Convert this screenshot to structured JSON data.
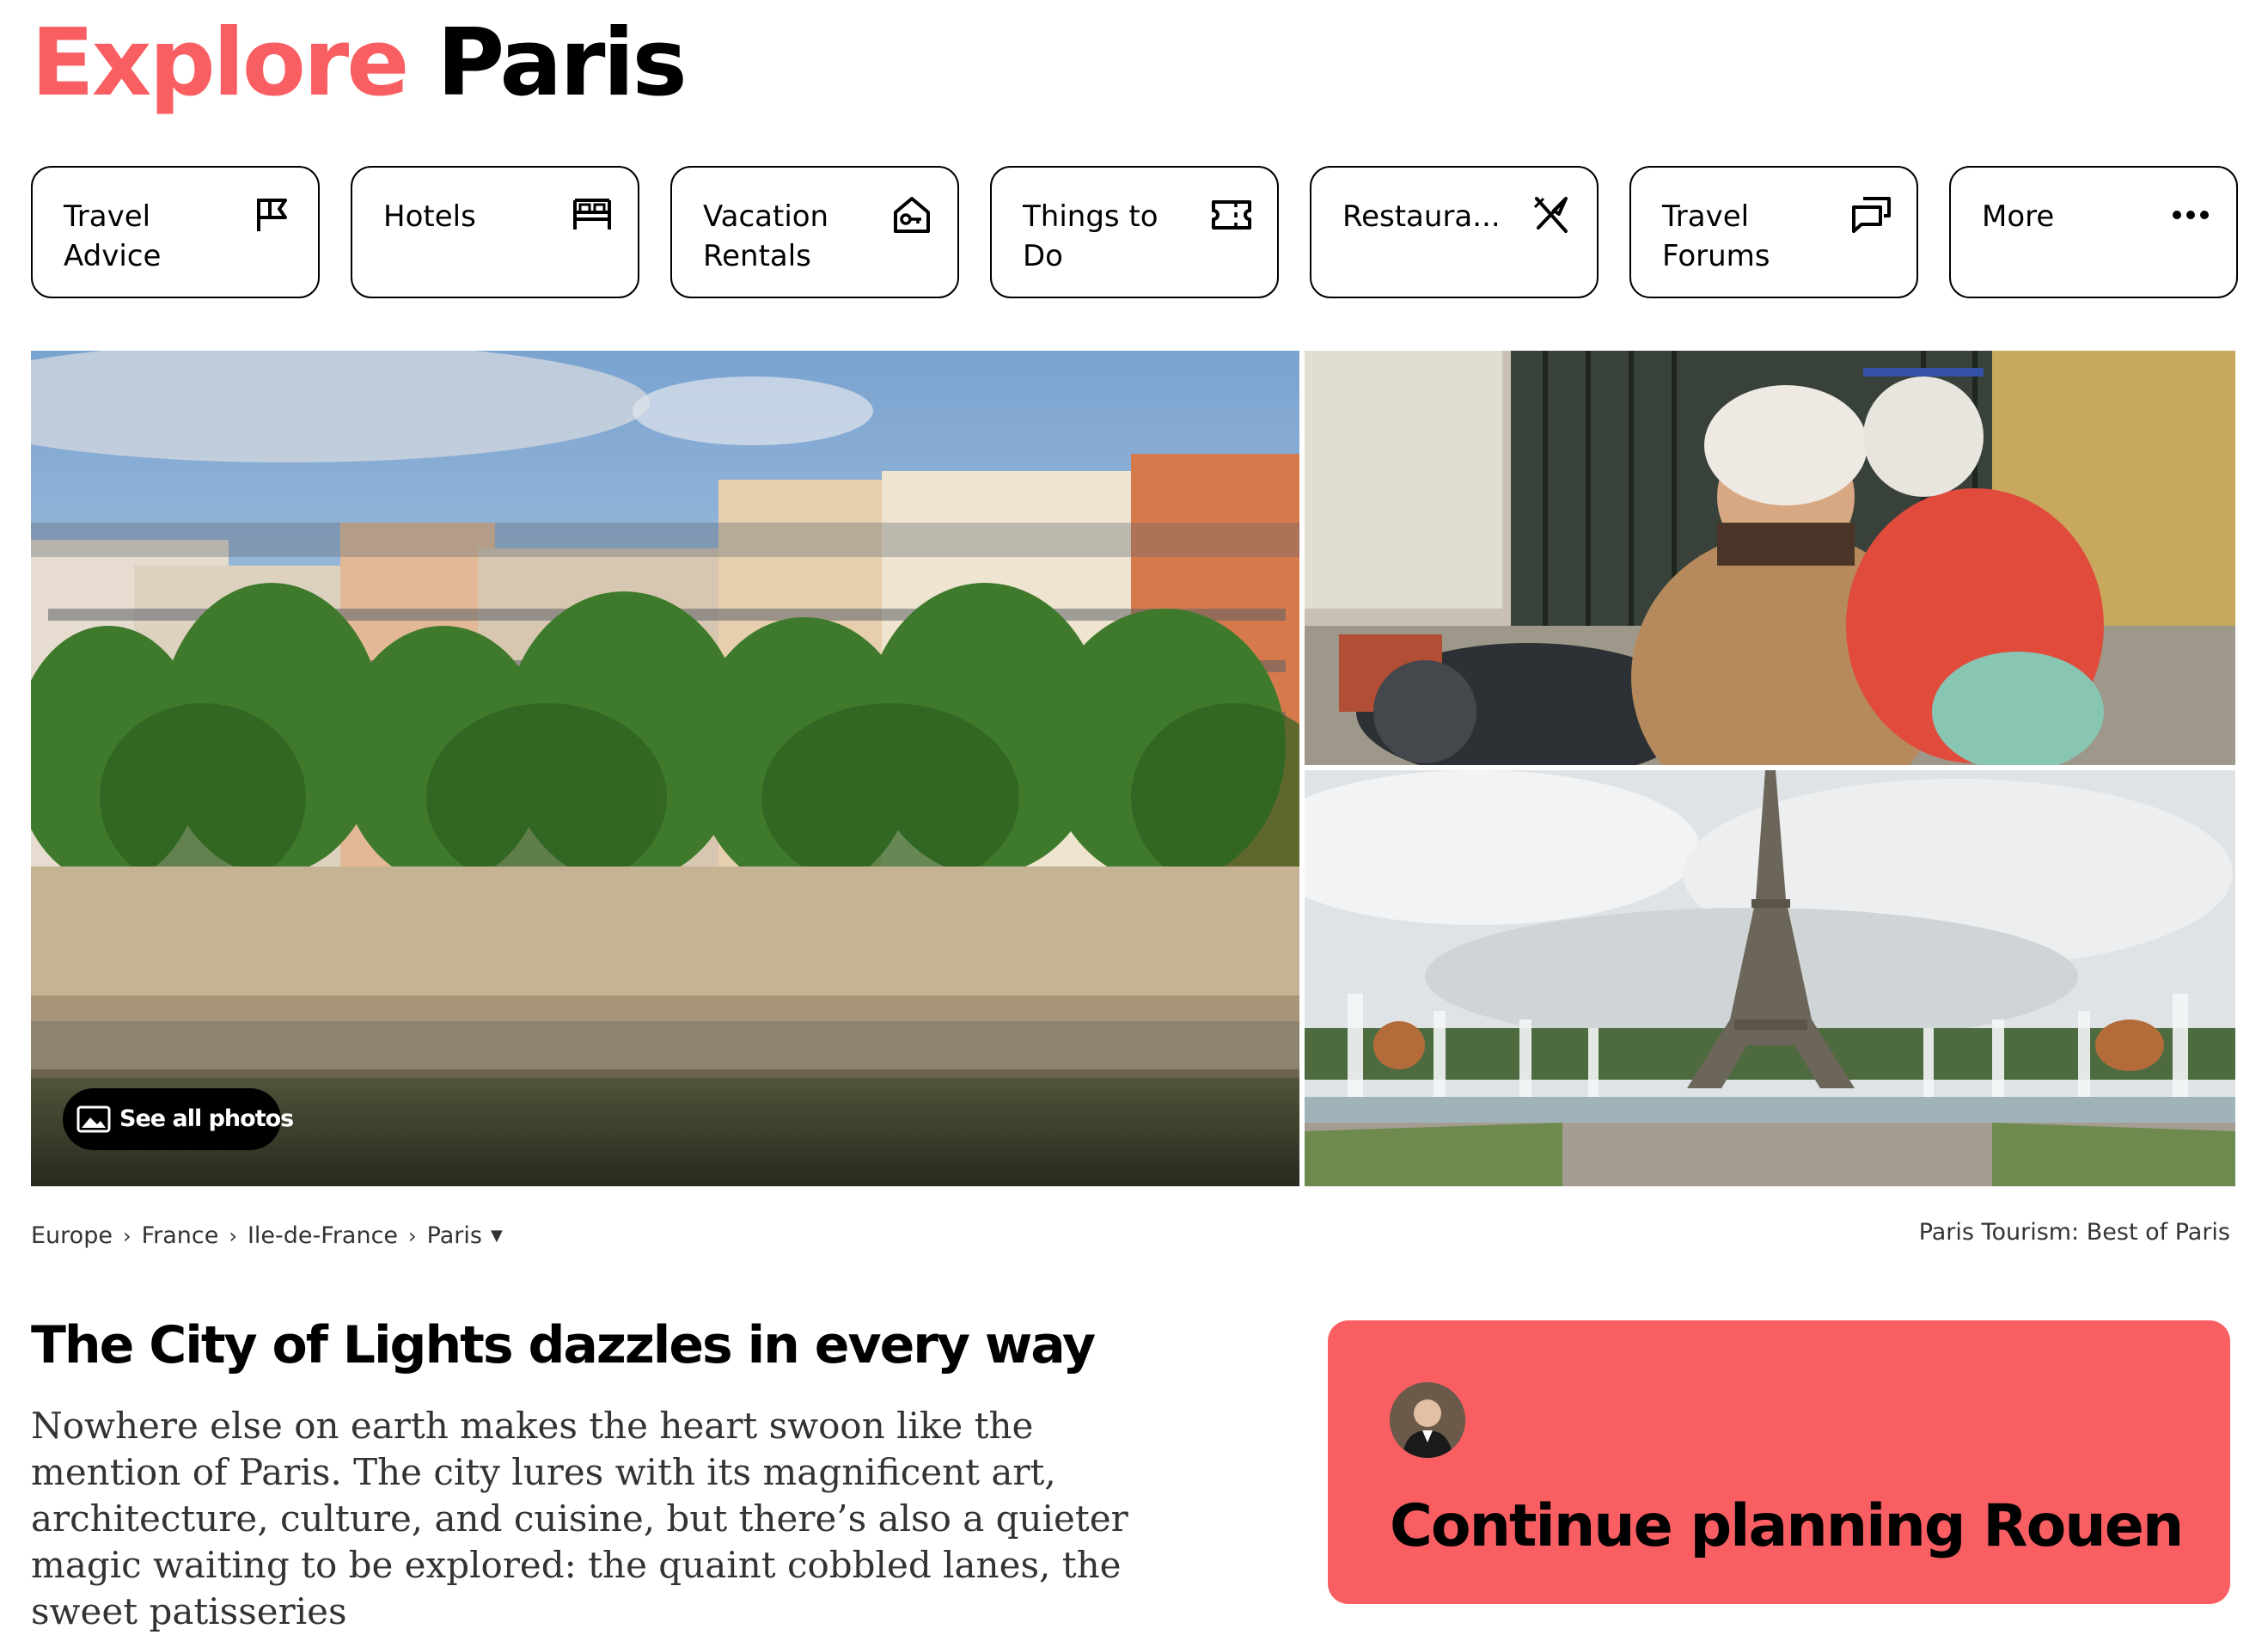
{
  "page": {
    "title_accent": "Explore",
    "title_city": "Paris"
  },
  "nav": [
    {
      "label": "Travel Advice",
      "icon": "flag-icon"
    },
    {
      "label": "Hotels",
      "icon": "bed-icon"
    },
    {
      "label": "Vacation Rentals",
      "icon": "house-key-icon"
    },
    {
      "label": "Things to Do",
      "icon": "ticket-icon"
    },
    {
      "label": "Restaura...",
      "icon": "fork-knife-icon"
    },
    {
      "label": "Travel Forums",
      "icon": "forum-icon"
    },
    {
      "label": "More",
      "icon": "ellipsis-icon"
    }
  ],
  "gallery": {
    "see_all_label": "See all photos"
  },
  "breadcrumb": [
    "Europe",
    "France",
    "Ile-de-France",
    "Paris"
  ],
  "tourism_label": "Paris Tourism: Best of Paris",
  "intro": {
    "headline": "The City of Lights dazzles in every way",
    "body": "Nowhere else on earth makes the heart swoon like the mention of Paris. The city lures with its magnificent art, architecture, culture, and cuisine, but there’s also a quieter magic waiting to be explored: the quaint cobbled lanes, the sweet patisseries"
  },
  "promo": {
    "title": "Continue planning Rouen"
  },
  "colors": {
    "accent": "#f95f62",
    "text": "#000000",
    "muted": "#333333"
  }
}
